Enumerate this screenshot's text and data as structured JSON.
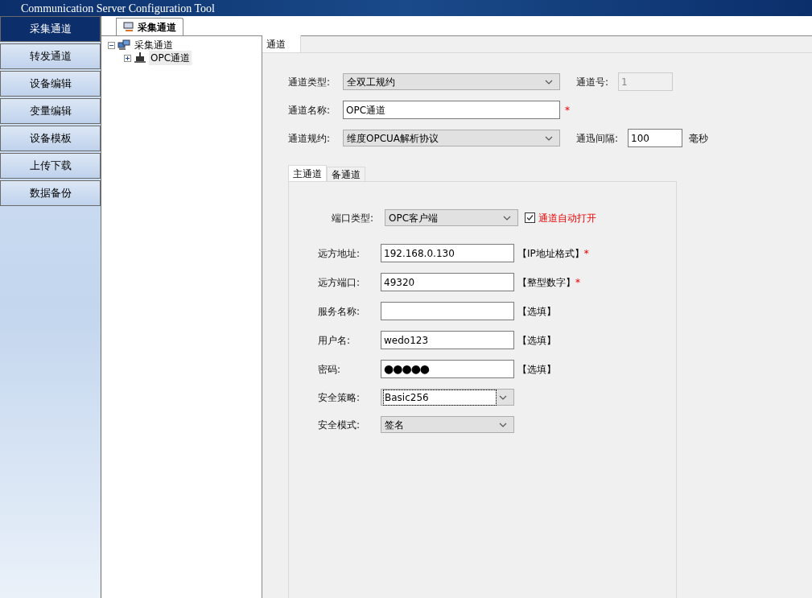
{
  "window": {
    "title": "Communication Server Configuration Tool"
  },
  "nav": [
    {
      "label": "采集通道",
      "selected": true
    },
    {
      "label": "转发通道",
      "selected": false
    },
    {
      "label": "设备编辑",
      "selected": false
    },
    {
      "label": "变量编辑",
      "selected": false
    },
    {
      "label": "设备模板",
      "selected": false
    },
    {
      "label": "上传下载",
      "selected": false
    },
    {
      "label": "数据备份",
      "selected": false
    }
  ],
  "doc_tab": {
    "label": "采集通道",
    "selected": true
  },
  "tree": [
    {
      "label": "采集通道",
      "expanded": true,
      "children": [
        {
          "label": "OPC通道",
          "expanded": false,
          "selected": true
        }
      ]
    }
  ],
  "panel_tab": {
    "label": "通道",
    "selected": true
  },
  "channel": {
    "type": {
      "label": "通道类型:",
      "value": "全双工规约"
    },
    "number": {
      "label": "通道号:",
      "value": "1",
      "disabled": true
    },
    "name": {
      "label": "通道名称:",
      "value": "OPC通道",
      "required_mark": "*"
    },
    "protocol": {
      "label": "通道规约:",
      "value": "维度OPCUA解析协议"
    },
    "interval": {
      "label": "通迅间隔:",
      "value": "100",
      "unit": "毫秒"
    }
  },
  "sub_tabs": [
    {
      "label": "主通道",
      "selected": true
    },
    {
      "label": "备通道",
      "selected": false
    }
  ],
  "port_type": {
    "label": "端口类型:",
    "value": "OPC客户端"
  },
  "auto_open": {
    "label": "通道自动打开",
    "checked": true
  },
  "fields": [
    {
      "kind": "input",
      "label": "远方地址:",
      "value": "192.168.0.130",
      "hint": "【IP地址格式】",
      "required_mark": "*"
    },
    {
      "kind": "input",
      "label": "远方端口:",
      "value": "49320",
      "hint": "【整型数字】",
      "required_mark": "*"
    },
    {
      "kind": "input",
      "label": "服务名称:",
      "hint": "【选填】"
    },
    {
      "kind": "input",
      "label": "用户名:",
      "value": "wedo123",
      "hint": "【选填】"
    },
    {
      "kind": "password",
      "label": "密码:",
      "value": "●●●●●",
      "hint": "【选填】"
    },
    {
      "kind": "select",
      "label": "安全策略:",
      "value": "Basic256",
      "focused": true
    },
    {
      "kind": "select",
      "label": "安全模式:",
      "value": "签名",
      "focused": false
    }
  ]
}
